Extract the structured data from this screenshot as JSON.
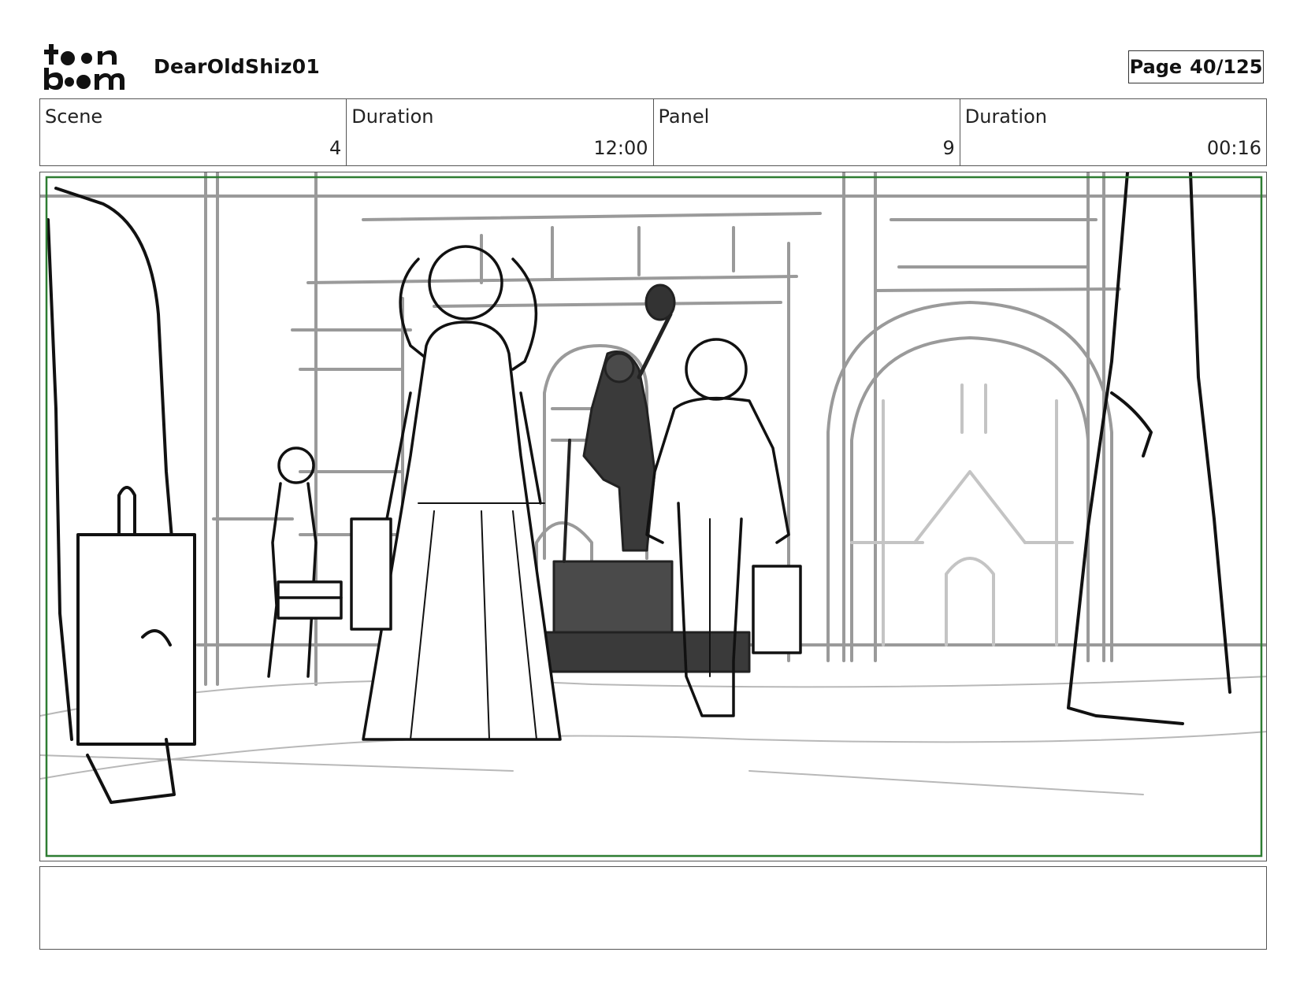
{
  "header": {
    "logo_text": "toon boom",
    "project_title": "DearOldShiz01",
    "page_label": "Page",
    "page_value": "40/125"
  },
  "info": {
    "scene_label": "Scene",
    "scene_value": "4",
    "scene_duration_label": "Duration",
    "scene_duration_value": "12:00",
    "panel_label": "Panel",
    "panel_value": "9",
    "panel_duration_label": "Duration",
    "panel_duration_value": "00:16"
  },
  "notes": {
    "text": ""
  },
  "colors": {
    "safe_frame": "#2e7d32",
    "statue": "#3a3a3a"
  }
}
